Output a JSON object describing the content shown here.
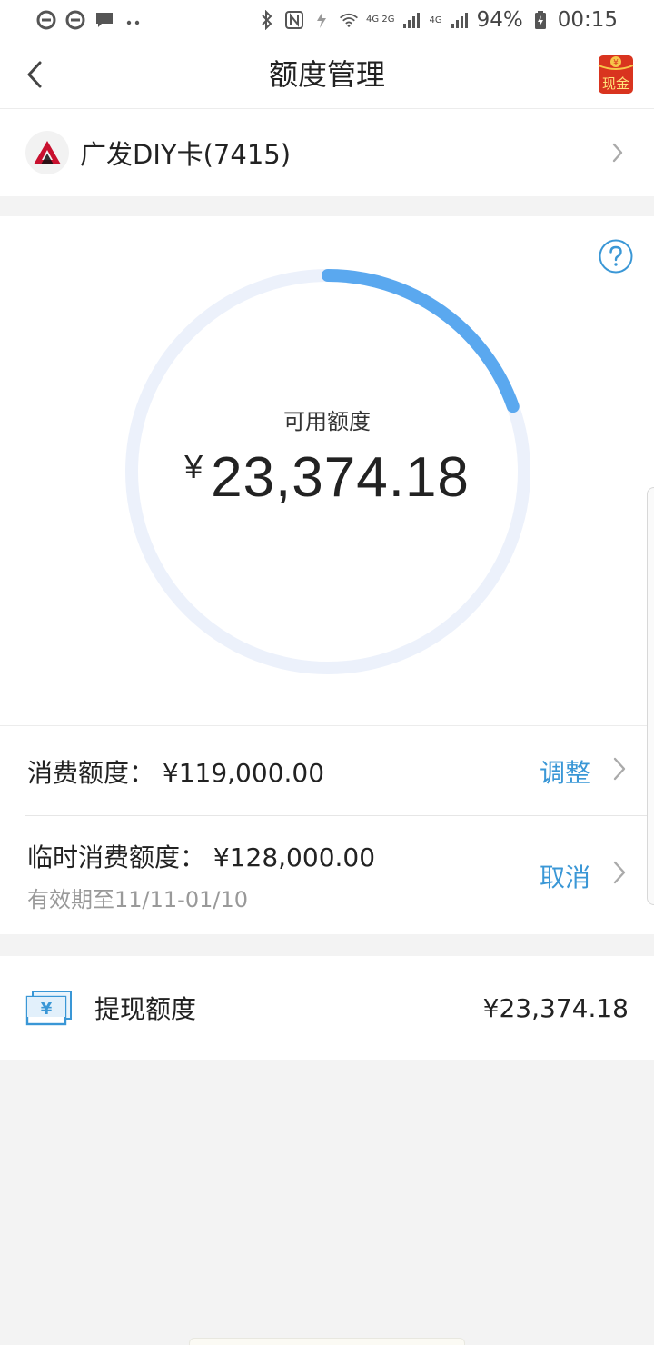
{
  "status_bar": {
    "left_icons": [
      "e-browser-icon",
      "e-browser-icon",
      "message-icon",
      "more-dots-icon"
    ],
    "right_icons": [
      "bluetooth-icon",
      "nfc-icon",
      "data-saver-icon",
      "wifi-icon",
      "signal-4g-icon",
      "signal-4g-icon",
      "battery-icon"
    ],
    "network_1": "4G 2G",
    "network_2": "4G",
    "battery": "94%",
    "time": "00:15"
  },
  "header": {
    "title": "额度管理",
    "back_icon": "chevron-left-icon",
    "badge_text": "现金",
    "badge_symbol": "¥"
  },
  "card": {
    "name": "广发DIY卡(7415)",
    "logo_color": "#c8102e"
  },
  "available": {
    "label": "可用额度",
    "currency": "¥",
    "amount": "23,374.18",
    "progress_fraction": 0.196,
    "ring_color": "#5aa8ef",
    "ring_track_color": "#ecf1fb"
  },
  "limits": {
    "consume_text": "消费额度： ¥119,000.00",
    "consume_action": "调整",
    "temp_text": "临时消费额度： ¥128,000.00",
    "temp_validity": "有效期至11/11-01/10",
    "temp_action": "取消",
    "accent": "#3a97d6"
  },
  "withdraw": {
    "label": "提现额度",
    "amount": "¥23,374.18",
    "icon": "cash-yen-icon",
    "icon_symbol": "¥"
  }
}
